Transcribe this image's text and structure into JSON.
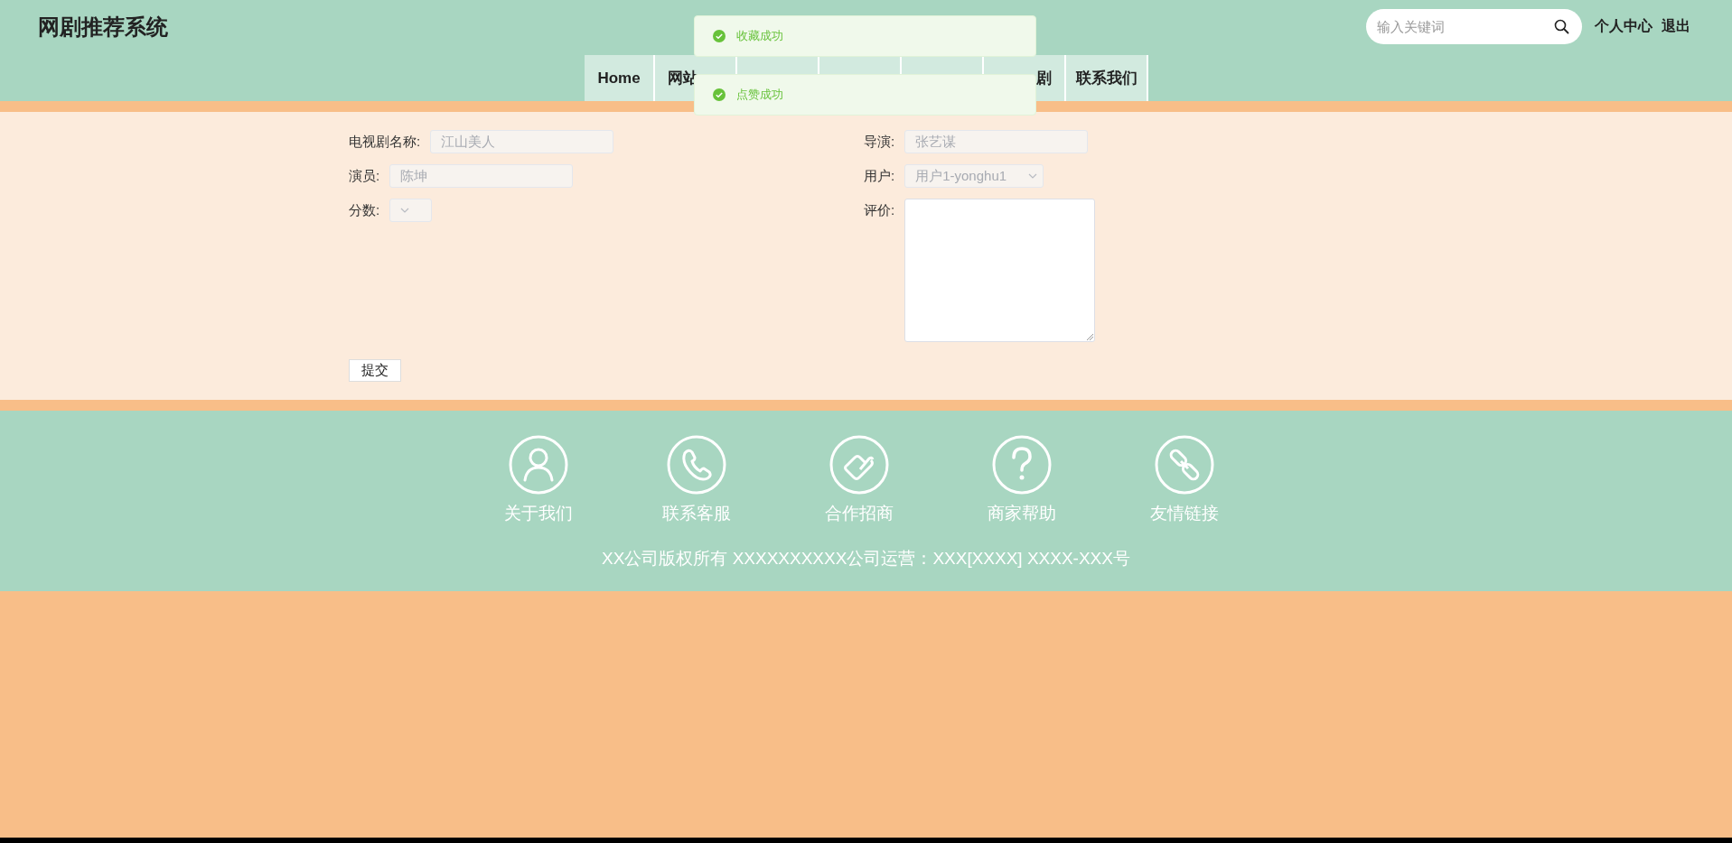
{
  "header": {
    "title": "网剧推荐系统",
    "search": {
      "placeholder": "输入关键词"
    },
    "links": [
      "个人中心",
      "退出"
    ]
  },
  "nav": [
    {
      "label": "Home",
      "kind": "full"
    },
    {
      "label": "网站",
      "kind": "cut_right"
    },
    {
      "kind": "hidden"
    },
    {
      "kind": "hidden"
    },
    {
      "kind": "hidden"
    },
    {
      "label": "剧",
      "kind": "cut_left"
    },
    {
      "label": "联系我们",
      "kind": "full"
    }
  ],
  "toasts": [
    {
      "kind": "success",
      "message": "收藏成功"
    },
    {
      "kind": "success",
      "message": "点赞成功"
    }
  ],
  "form": {
    "left": [
      {
        "label": "电视剧名称:",
        "kind": "input",
        "value": "江山美人",
        "disabled": true
      },
      {
        "label": "演员:",
        "kind": "input",
        "value": "陈坤",
        "disabled": true
      },
      {
        "label": "分数:",
        "kind": "select",
        "disabled": true
      }
    ],
    "right": [
      {
        "label": "导演:",
        "kind": "input",
        "value": "张艺谋",
        "disabled": true
      },
      {
        "label": "用户:",
        "kind": "select",
        "value": "用户1-yonghu1",
        "disabled": true
      },
      {
        "label": "评价:",
        "kind": "textarea",
        "disabled": false
      }
    ],
    "submit": "提交"
  },
  "footer": {
    "links": [
      "关于我们",
      "联系客服",
      "合作招商",
      "商家帮助",
      "友情链接"
    ],
    "copyright": "XX公司版权所有 XXXXXXXXXX公司运营：XXX[XXXX] XXXX-XXX号"
  }
}
